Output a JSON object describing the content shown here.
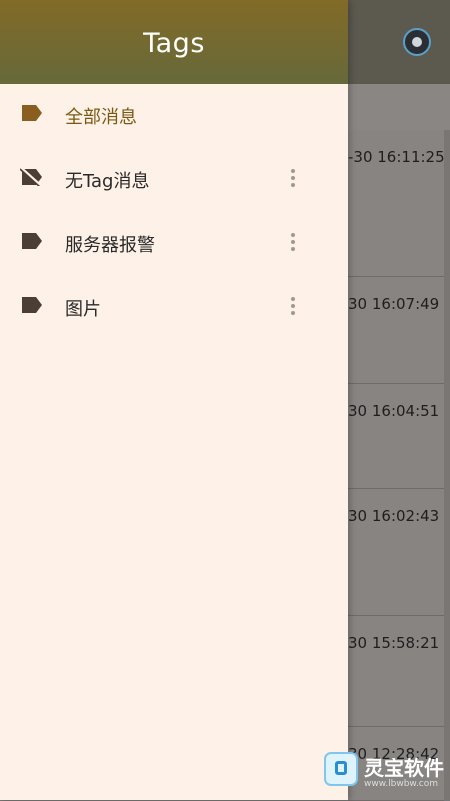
{
  "drawer": {
    "title": "Tags",
    "items": [
      {
        "label": "全部消息",
        "icon": "tag-icon",
        "active": true
      },
      {
        "label": "无Tag消息",
        "icon": "tag-off-icon",
        "has_menu": true
      },
      {
        "label": "服务器报警",
        "icon": "tag-icon",
        "has_menu": true
      },
      {
        "label": "图片",
        "icon": "tag-icon",
        "has_menu": true
      }
    ]
  },
  "background": {
    "messages": [
      {
        "time": "-30 16:11:25"
      },
      {
        "time": "30 16:07:49"
      },
      {
        "time": "30 16:04:51"
      },
      {
        "time": "30 16:02:43"
      },
      {
        "time": "30 15:58:21"
      },
      {
        "time": "30 12:28:42"
      }
    ]
  },
  "watermark": {
    "brand": "灵宝软件",
    "url": "www.lbwbw.com"
  },
  "colors": {
    "accent": "#7a5a12",
    "tag_active": "#8a5e1e",
    "tag_normal": "#4a3f36",
    "drawer_bg": "#fef1e7"
  }
}
